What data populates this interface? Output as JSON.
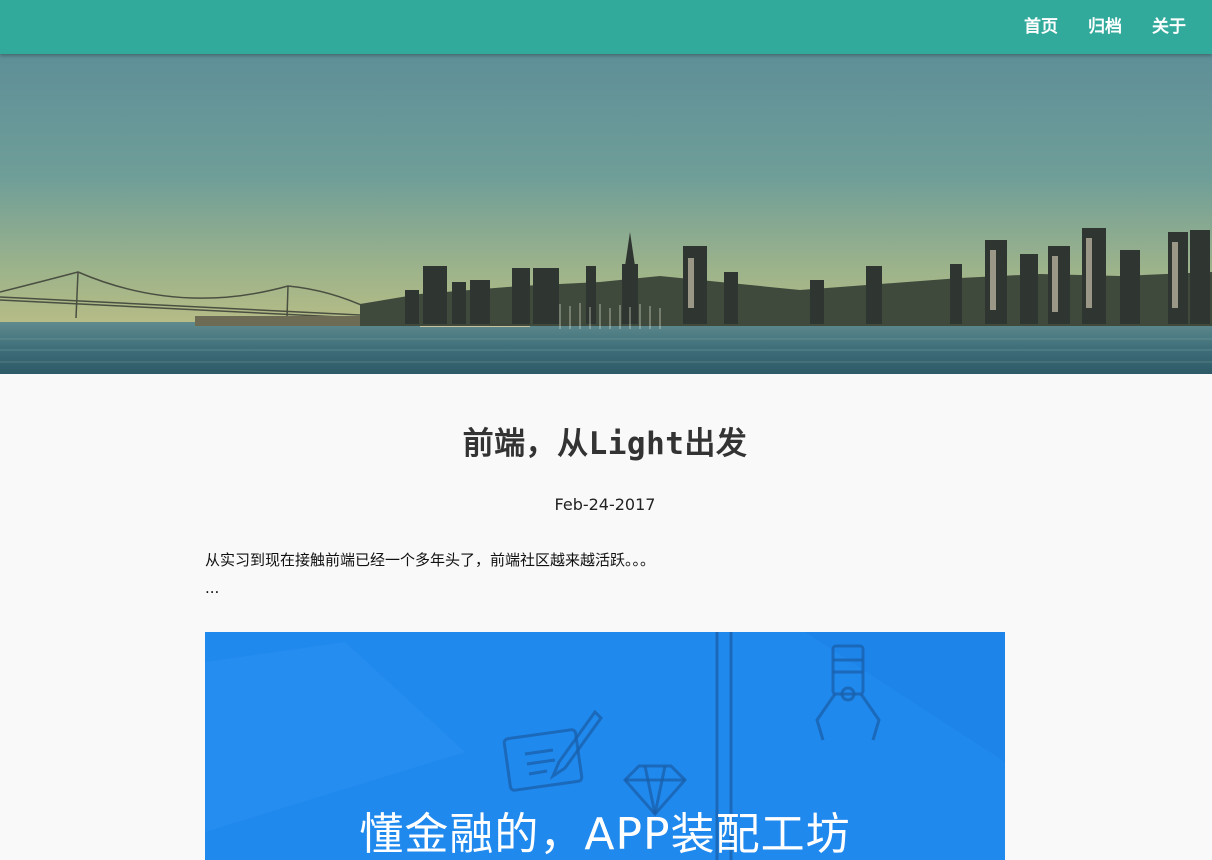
{
  "nav": {
    "items": [
      {
        "label": "首页"
      },
      {
        "label": "归档"
      },
      {
        "label": "关于"
      }
    ]
  },
  "post": {
    "title": "前端，从Light出发",
    "date": "Feb-24-2017",
    "excerpt_line1": "从实习到现在接触前端已经一个多年头了，前端社区越来越活跃。。。",
    "excerpt_line2": "..."
  },
  "banner": {
    "text": "懂金融的，APP装配工坊"
  },
  "colors": {
    "topbar": "#31aa9c",
    "banner": "#2089ee",
    "page_bg": "#f8f9f8"
  }
}
